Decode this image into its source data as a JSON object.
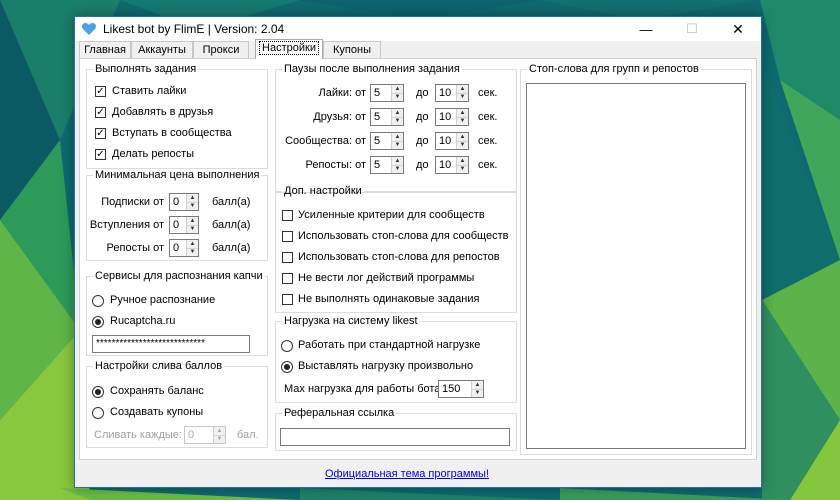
{
  "window": {
    "title": "Likest bot by FlimE | Version: 2.04",
    "min_glyph": "—",
    "max_glyph": "☐",
    "close_glyph": "✕"
  },
  "tabs": [
    {
      "label": "Главная"
    },
    {
      "label": "Аккаунты"
    },
    {
      "label": "Прокси"
    },
    {
      "label": "Настройки",
      "active": true
    },
    {
      "label": "Купоны"
    }
  ],
  "tasks": {
    "title": "Выполнять задания",
    "items": [
      {
        "label": "Ставить лайки",
        "checked": true
      },
      {
        "label": "Добавлять в друзья",
        "checked": true
      },
      {
        "label": "Вступать в сообщества",
        "checked": true
      },
      {
        "label": "Делать репосты",
        "checked": true
      }
    ]
  },
  "min_price": {
    "title": "Минимальная цена выполнения",
    "unit": "балл(а)",
    "rows": [
      {
        "label": "Подписки от",
        "value": "0"
      },
      {
        "label": "Вступления от",
        "value": "0"
      },
      {
        "label": "Репосты от",
        "value": "0"
      }
    ]
  },
  "captcha": {
    "title": "Сервисы для распознания капчи",
    "options": [
      {
        "label": "Ручное распознание",
        "selected": false
      },
      {
        "label": "Rucaptcha.ru",
        "selected": true
      }
    ],
    "key_value": "****************************"
  },
  "drain": {
    "title": "Настройки слива баллов",
    "options": [
      {
        "label": "Сохранять баланс",
        "selected": true
      },
      {
        "label": "Создавать купоны",
        "selected": false
      }
    ],
    "every_label": "Сливать каждые:",
    "every_value": "0",
    "unit": "бал."
  },
  "pauses": {
    "title": "Паузы после выполнения задания",
    "from_label": "",
    "to_label": "до",
    "unit": "сек.",
    "rows": [
      {
        "label": "Лайки: от",
        "from": "5",
        "to": "10"
      },
      {
        "label": "Друзья: от",
        "from": "5",
        "to": "10"
      },
      {
        "label": "Сообщества: от",
        "from": "5",
        "to": "10"
      },
      {
        "label": "Репосты: от",
        "from": "5",
        "to": "10"
      }
    ]
  },
  "extra": {
    "title": "Доп. настройки",
    "items": [
      {
        "label": "Усиленные критерии для сообществ",
        "checked": false
      },
      {
        "label": "Использовать стоп-слова для сообществ",
        "checked": false
      },
      {
        "label": "Использовать стоп-слова для репостов",
        "checked": false
      },
      {
        "label": "Не вести лог действий программы",
        "checked": false
      },
      {
        "label": "Не выполнять одинаковые задания",
        "checked": false
      }
    ]
  },
  "load": {
    "title": "Нагрузка на систему likest",
    "options": [
      {
        "label": "Работать при стандартной нагрузке",
        "selected": false
      },
      {
        "label": "Выставлять нагрузку произвольно",
        "selected": true
      }
    ],
    "max_label": "Мах нагрузка для работы бота:",
    "max_value": "150"
  },
  "referral": {
    "title": "Реферальная ссылка",
    "value": ""
  },
  "stopwords": {
    "title": "Стоп-слова для групп и репостов"
  },
  "footer": {
    "link": "Официальная тема программы!"
  },
  "glyphs": {
    "check": "✓",
    "up": "▲",
    "down": "▼"
  },
  "colors": {
    "accent_border": "#2b6fb3",
    "link": "#0000ee",
    "heart": "#4aa3df"
  }
}
